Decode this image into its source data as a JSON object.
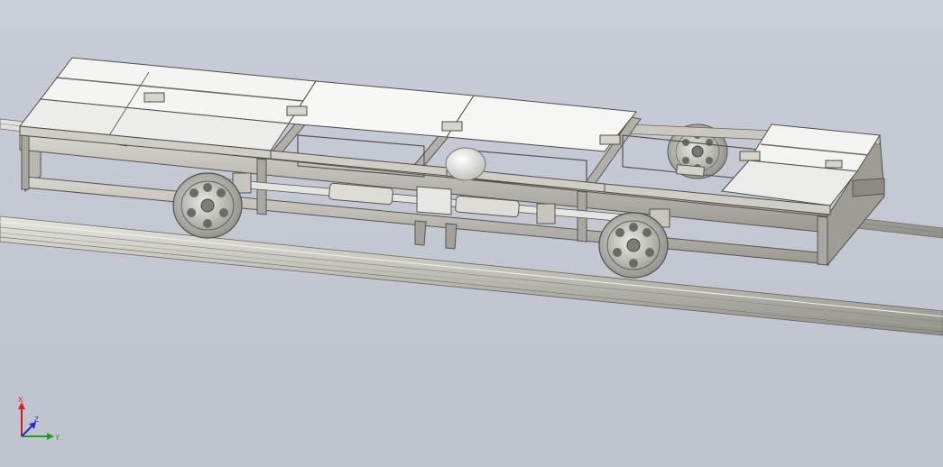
{
  "viewport": {
    "background": "#c4c8d3",
    "model": {
      "name": "",
      "components": [
        "rail-left",
        "rail-right",
        "chassis-frame",
        "deck-panels",
        "wheel-front-left",
        "wheel-front-right",
        "wheel-rear-left",
        "drive-shaft",
        "gearbox",
        "bearing-blocks"
      ]
    }
  },
  "triad": {
    "x_label": "X",
    "y_label": "Y",
    "z_label": "Z",
    "colors": {
      "x": "#d02020",
      "y": "#20a020",
      "z": "#2030d0"
    }
  }
}
